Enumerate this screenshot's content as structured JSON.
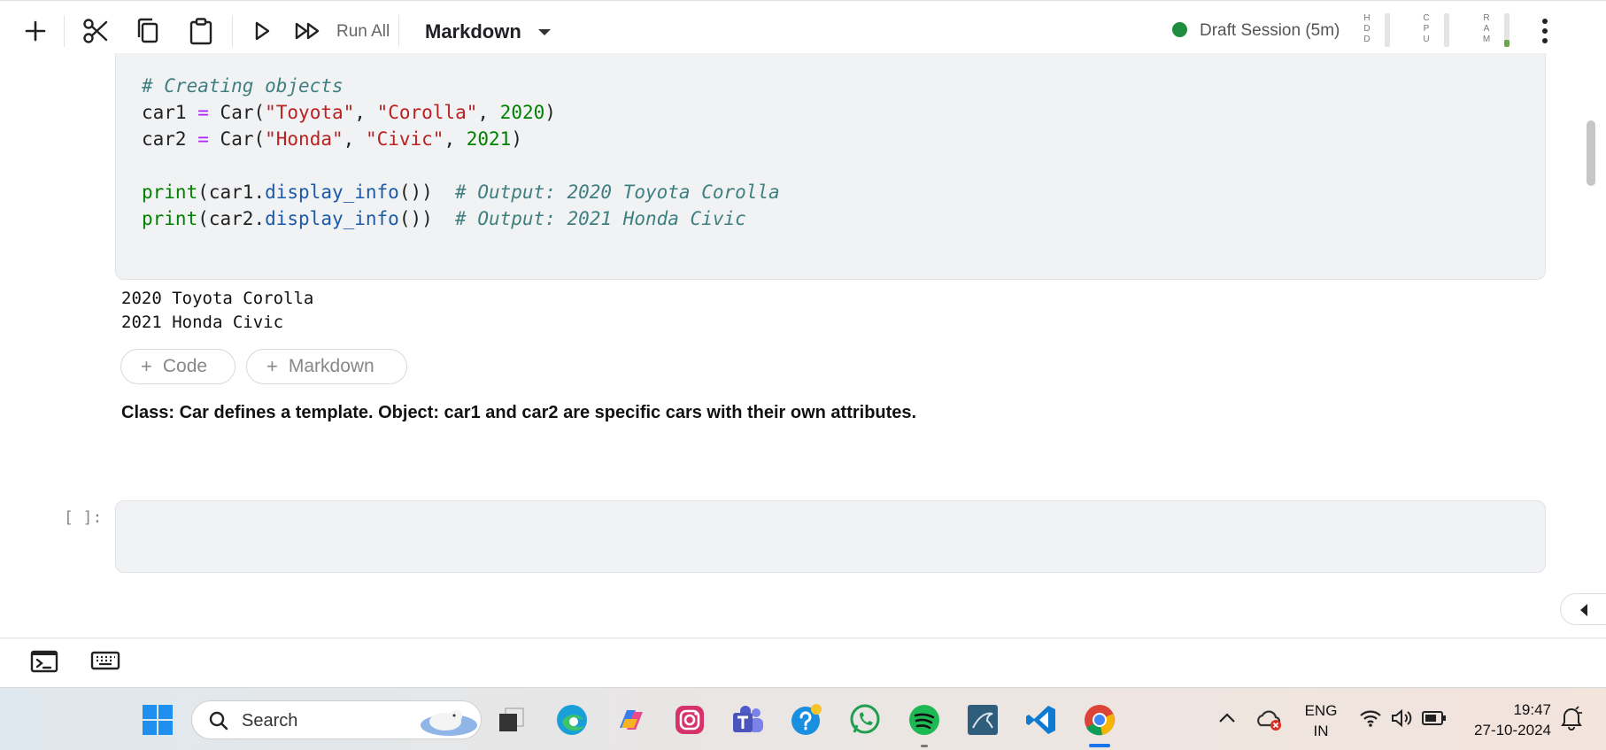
{
  "toolbar": {
    "run_all_label": "Run All",
    "cell_type": "Markdown",
    "session_label": "Draft Session (5m)",
    "session_status_color": "#1e8e3e",
    "meters": [
      {
        "label": "HDD",
        "level": 0.0
      },
      {
        "label": "CPU",
        "level": 0.0
      },
      {
        "label": "RAM",
        "level": 0.2
      }
    ],
    "icons": [
      "add-icon",
      "cut-icon",
      "copy-icon",
      "paste-icon",
      "run-icon",
      "run-all-icon",
      "chevron-down-icon",
      "more-vert-icon"
    ]
  },
  "code_cell": {
    "lines": [
      {
        "comment": "# Creating objects"
      },
      {
        "var": "car1",
        "op": "=",
        "fn": "Car(",
        "s1": "\"Toyota\"",
        "s2": "\"Corolla\"",
        "num": "2020"
      },
      {
        "var": "car2",
        "op": "=",
        "fn": "Car(",
        "s1": "\"Honda\"",
        "s2": "\"Civic\"",
        "num": "2021"
      },
      {
        "print": "print",
        "arg": "car1",
        "method": "display_info",
        "comment": "# Output: 2020 Toyota Corolla"
      },
      {
        "print": "print",
        "arg": "car2",
        "method": "display_info",
        "comment": "# Output: 2021 Honda Civic"
      }
    ]
  },
  "output": {
    "lines": [
      "2020 Toyota Corolla",
      "2021 Honda Civic"
    ]
  },
  "add_buttons": {
    "code_label": "Code",
    "markdown_label": "Markdown"
  },
  "markdown_cell": {
    "text": "Class: Car defines a template. Object: car1 and car2 are specific cars with their own attributes."
  },
  "empty_cell": {
    "prompt": "[ ]:"
  },
  "taskbar": {
    "search_label": "Search",
    "language": [
      "ENG",
      "IN"
    ],
    "time": "19:47",
    "date": "27-10-2024",
    "apps": [
      "windows-start-icon",
      "task-view-icon",
      "edge-icon",
      "copilot-icon",
      "instagram-icon",
      "teams-icon",
      "help-icon",
      "whatsapp-icon",
      "spotify-icon",
      "mysql-icon",
      "vscode-icon",
      "chrome-icon"
    ]
  }
}
